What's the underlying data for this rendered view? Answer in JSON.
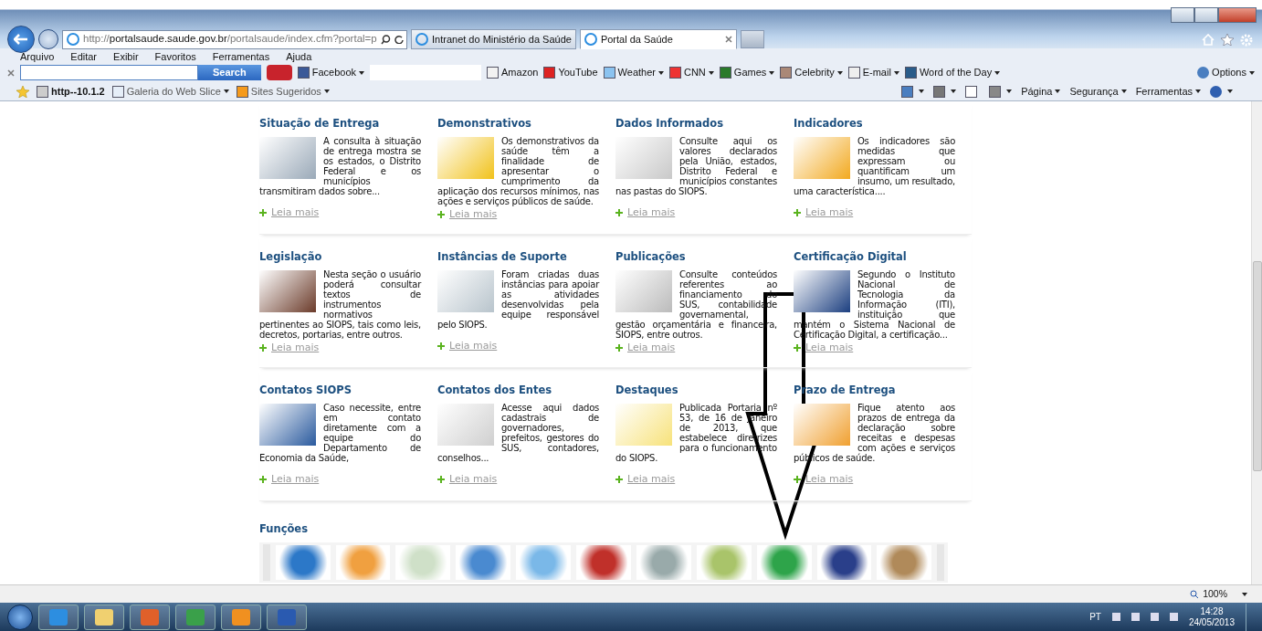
{
  "browser": {
    "address": "http://**portalsaude.saude.gov.br**/portalsaude/index.cfm?portal=p",
    "tabs": [
      {
        "title": "Intranet do Ministério da Saúde",
        "selected": false
      },
      {
        "title": "Portal da Saúde",
        "selected": true
      }
    ],
    "menu": [
      "Arquivo",
      "Editar",
      "Exibir",
      "Favoritos",
      "Ferramentas",
      "Ajuda"
    ],
    "search_button": "Search",
    "toolbar": [
      {
        "label": "Facebook",
        "dropdown": true
      },
      {
        "label": "Amazon",
        "dropdown": false
      },
      {
        "label": "YouTube",
        "dropdown": false
      },
      {
        "label": "Weather",
        "dropdown": true
      },
      {
        "label": "CNN",
        "dropdown": true
      },
      {
        "label": "Games",
        "dropdown": true
      },
      {
        "label": "Celebrity",
        "dropdown": true
      },
      {
        "label": "E-mail",
        "dropdown": true
      },
      {
        "label": "Word of the Day",
        "dropdown": true
      }
    ],
    "options": "Options",
    "favorites": [
      {
        "label": "http--10.1.2",
        "dropdown": false
      },
      {
        "label": "Galeria do Web Slice",
        "dropdown": true
      },
      {
        "label": "Sites Sugeridos",
        "dropdown": true
      }
    ],
    "command_bar": [
      "Página",
      "Segurança",
      "Ferramentas"
    ]
  },
  "sections": [
    {
      "title": "Situação de Entrega",
      "text": "A consulta à situação de entrega mostra se os estados, o Distrito Federal e os municípios transmitiram dados sobre...",
      "link": "Leia mais"
    },
    {
      "title": "Demonstrativos",
      "text": "Os demonstrativos da saúde têm a finalidade de apresentar o cumprimento da aplicação dos recursos mínimos, nas ações e serviços públicos de saúde.",
      "link": "Leia mais"
    },
    {
      "title": "Dados Informados",
      "text": "Consulte aqui os valores declarados pela União, estados, Distrito Federal e municípios constantes nas pastas do SIOPS.",
      "link": "Leia mais"
    },
    {
      "title": "Indicadores",
      "text": "Os indicadores são medidas que expressam ou quantificam um insumo, um resultado, uma característica....",
      "link": "Leia mais"
    },
    {
      "title": "Legislação",
      "text": "Nesta seção o usuário poderá consultar textos de instrumentos normativos pertinentes ao SIOPS, tais como leis, decretos, portarias, entre outros.",
      "link": "Leia mais"
    },
    {
      "title": "Instâncias de Suporte",
      "text": "Foram criadas duas instâncias para apoiar as atividades desenvolvidas pela equipe responsável pelo SIOPS.",
      "link": "Leia mais"
    },
    {
      "title": "Publicações",
      "text": "Consulte conteúdos referentes ao financiamento do SUS, contabilidade governamental, gestão orçamentária e financeira, SIOPS, entre outros.",
      "link": "Leia mais"
    },
    {
      "title": "Certificação Digital",
      "text": "Segundo o Instituto Nacional de Tecnologia da Informação (ITI), instituição que mantém o Sistema Nacional de Certificação Digital, a certificação...",
      "link": "Leia mais"
    },
    {
      "title": "Contatos SIOPS",
      "text": "Caso necessite, entre em contato diretamente com a equipe do Departamento de Economia da Saúde,",
      "link": "Leia mais"
    },
    {
      "title": "Contatos dos Entes",
      "text": "Acesse aqui dados cadastrais de governadores, prefeitos, gestores do SUS, contadores, conselhos...",
      "link": "Leia mais"
    },
    {
      "title": "Destaques",
      "text": "Publicada Portaria nº 53, de 16 de Janeiro de 2013, que estabelece diretrizes para o funcionamento do SIOPS.",
      "link": "Leia mais"
    },
    {
      "title": "Prazo de Entrega",
      "text": "Fique atento aos prazos de entrega da declaração sobre receitas e despesas com ações e serviços públicos de saúde.",
      "link": "Leia mais"
    }
  ],
  "functions": {
    "title": "Funções"
  },
  "status_bar": {
    "zoom": "100%"
  },
  "taskbar": {
    "language": "PT",
    "time": "14:28",
    "date": "24/05/2013"
  }
}
